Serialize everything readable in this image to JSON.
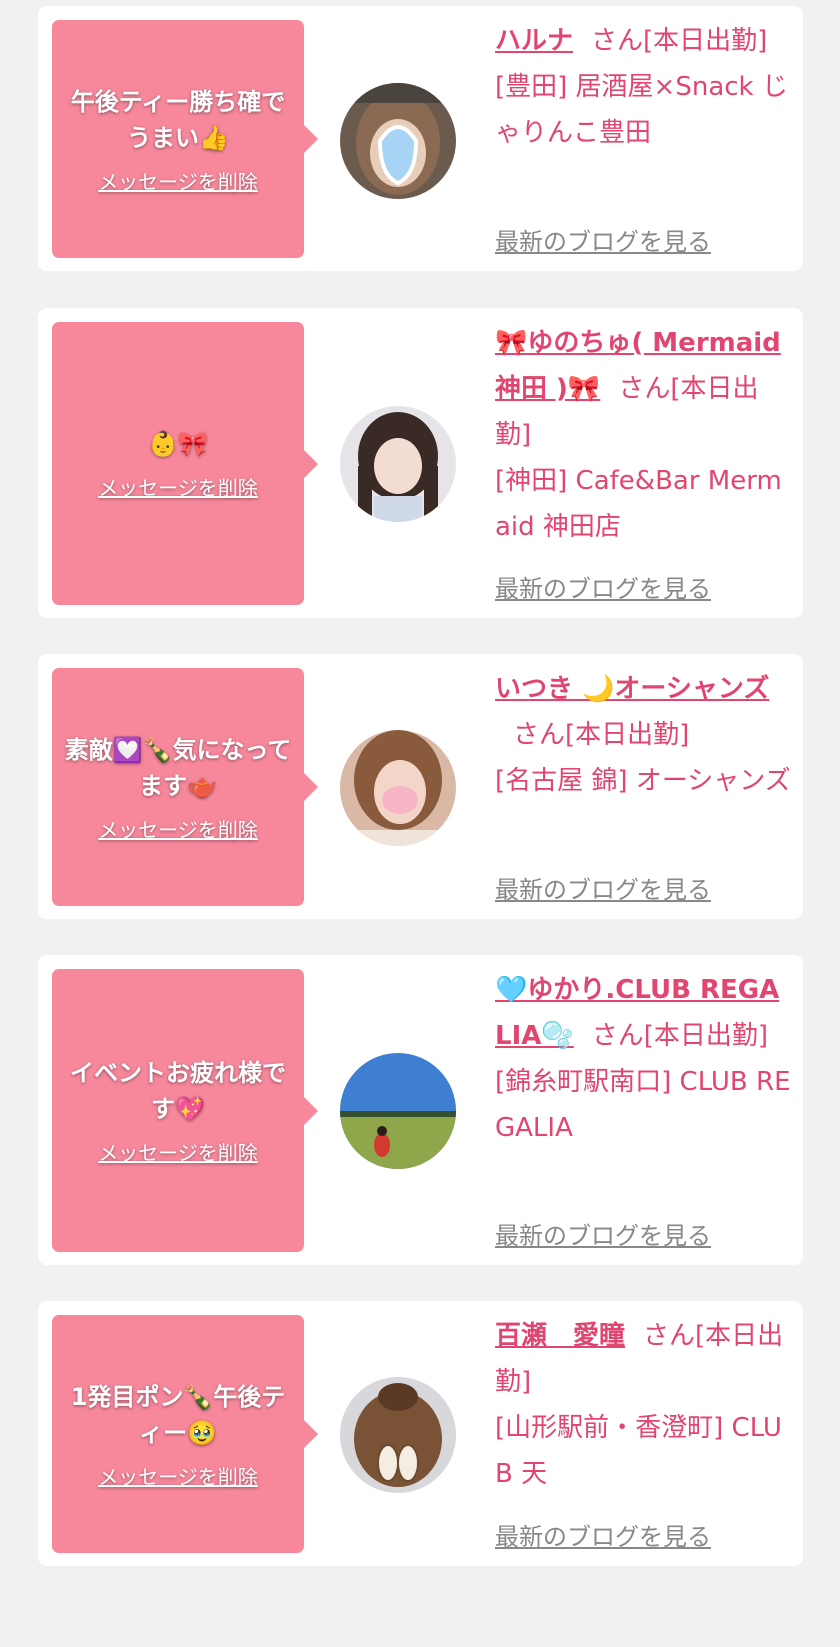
{
  "common": {
    "delete_label": "メッセージを削除",
    "blog_label": "最新のブログを見る",
    "san_label": "さん[本日出勤]"
  },
  "colors": {
    "bubble": "#f7889c",
    "accent": "#e0466f",
    "link_gray": "#888888",
    "background": "#f1f1f1"
  },
  "cards": [
    {
      "message": "午後ティー勝ち確でうまい👍",
      "name": "ハルナ",
      "shop": "[豊田] 居酒屋×Snack じゃりんこ豊田"
    },
    {
      "message": "👶🎀",
      "name": "🎀ゆのちゅ( Mermaid 神田 )🎀",
      "shop": "[神田] Cafe&Bar Mermaid 神田店"
    },
    {
      "message": "素敵💟🍾気になってます🫖",
      "name": "いつき 🌙オーシャンズ",
      "shop": "[名古屋 錦] オーシャンズ"
    },
    {
      "message": "イベントお疲れ様です💖",
      "name": "🩵ゆかり.CLUB REGALIA🫧",
      "shop": "[錦糸町駅南口] CLUB REGALIA"
    },
    {
      "message": "1発目ポン🍾午後ティー🥹",
      "name": "百瀬　愛瞳",
      "shop": "[山形駅前・香澄町] CLUB 天"
    }
  ]
}
